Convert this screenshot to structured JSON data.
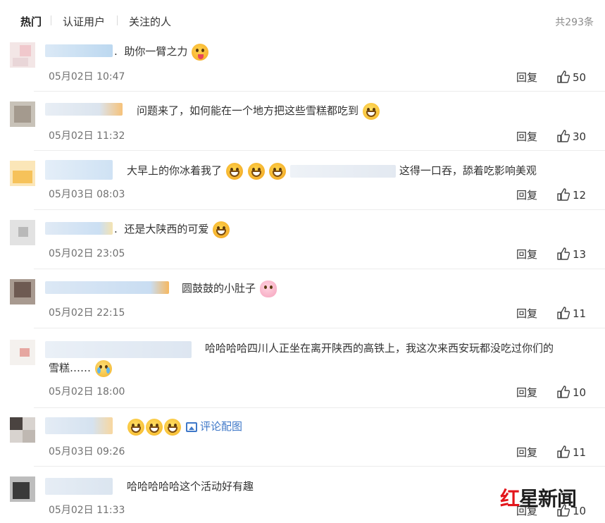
{
  "tabs": [
    {
      "label": "热门",
      "active": true
    },
    {
      "label": "认证用户",
      "active": false
    },
    {
      "label": "关注的人",
      "active": false
    }
  ],
  "total_count": "共293条",
  "reply_label": "回复",
  "comments": [
    {
      "text": "助你一臂之力",
      "prefix": ".",
      "emojis": [
        "tongue-emoji"
      ],
      "time": "05月02日 10:47",
      "likes": "50"
    },
    {
      "text": "问题来了，如何能在一个地方把这些雪糕都吃到",
      "emojis": [
        "grin-emoji"
      ],
      "time": "05月02日 11:32",
      "likes": "30"
    },
    {
      "text_before": "大早上的你冰着我了",
      "emojis": [
        "laugh-emoji",
        "laugh-emoji",
        "laugh-emoji"
      ],
      "text_after": "这得一口吞，舔着吃影响美观",
      "time": "05月03日 08:03",
      "likes": "12"
    },
    {
      "text": "还是大陕西的可爱",
      "prefix": ".",
      "emojis": [
        "laugh-emoji"
      ],
      "time": "05月02日 23:05",
      "likes": "13"
    },
    {
      "text": "圆鼓鼓的小肚子",
      "emojis": [
        "pig-emoji"
      ],
      "time": "05月02日 22:15",
      "likes": "11"
    },
    {
      "line1": "哈哈哈哈四川人正坐在离开陕西的高铁上，我这次来西安玩都没吃过你们的",
      "line2": "雪糕……",
      "emojis": [
        "cry-emoji"
      ],
      "time": "05月02日 18:00",
      "likes": "10"
    },
    {
      "emojis": [
        "grin-emoji",
        "grin-emoji",
        "grin-emoji"
      ],
      "link": "评论配图",
      "time": "05月03日 09:26",
      "likes": "11"
    },
    {
      "text": "哈哈哈哈哈这个活动好有趣",
      "time": "05月02日 11:33",
      "likes": "10"
    }
  ],
  "watermark": {
    "red": "红",
    "dark": "星",
    "rest": "新闻",
    "sub": "红星新闻"
  },
  "colors": {
    "link": "#3f78c8",
    "watermark_red": "#e3161c",
    "time": "#707070",
    "divider": "#ececec"
  }
}
